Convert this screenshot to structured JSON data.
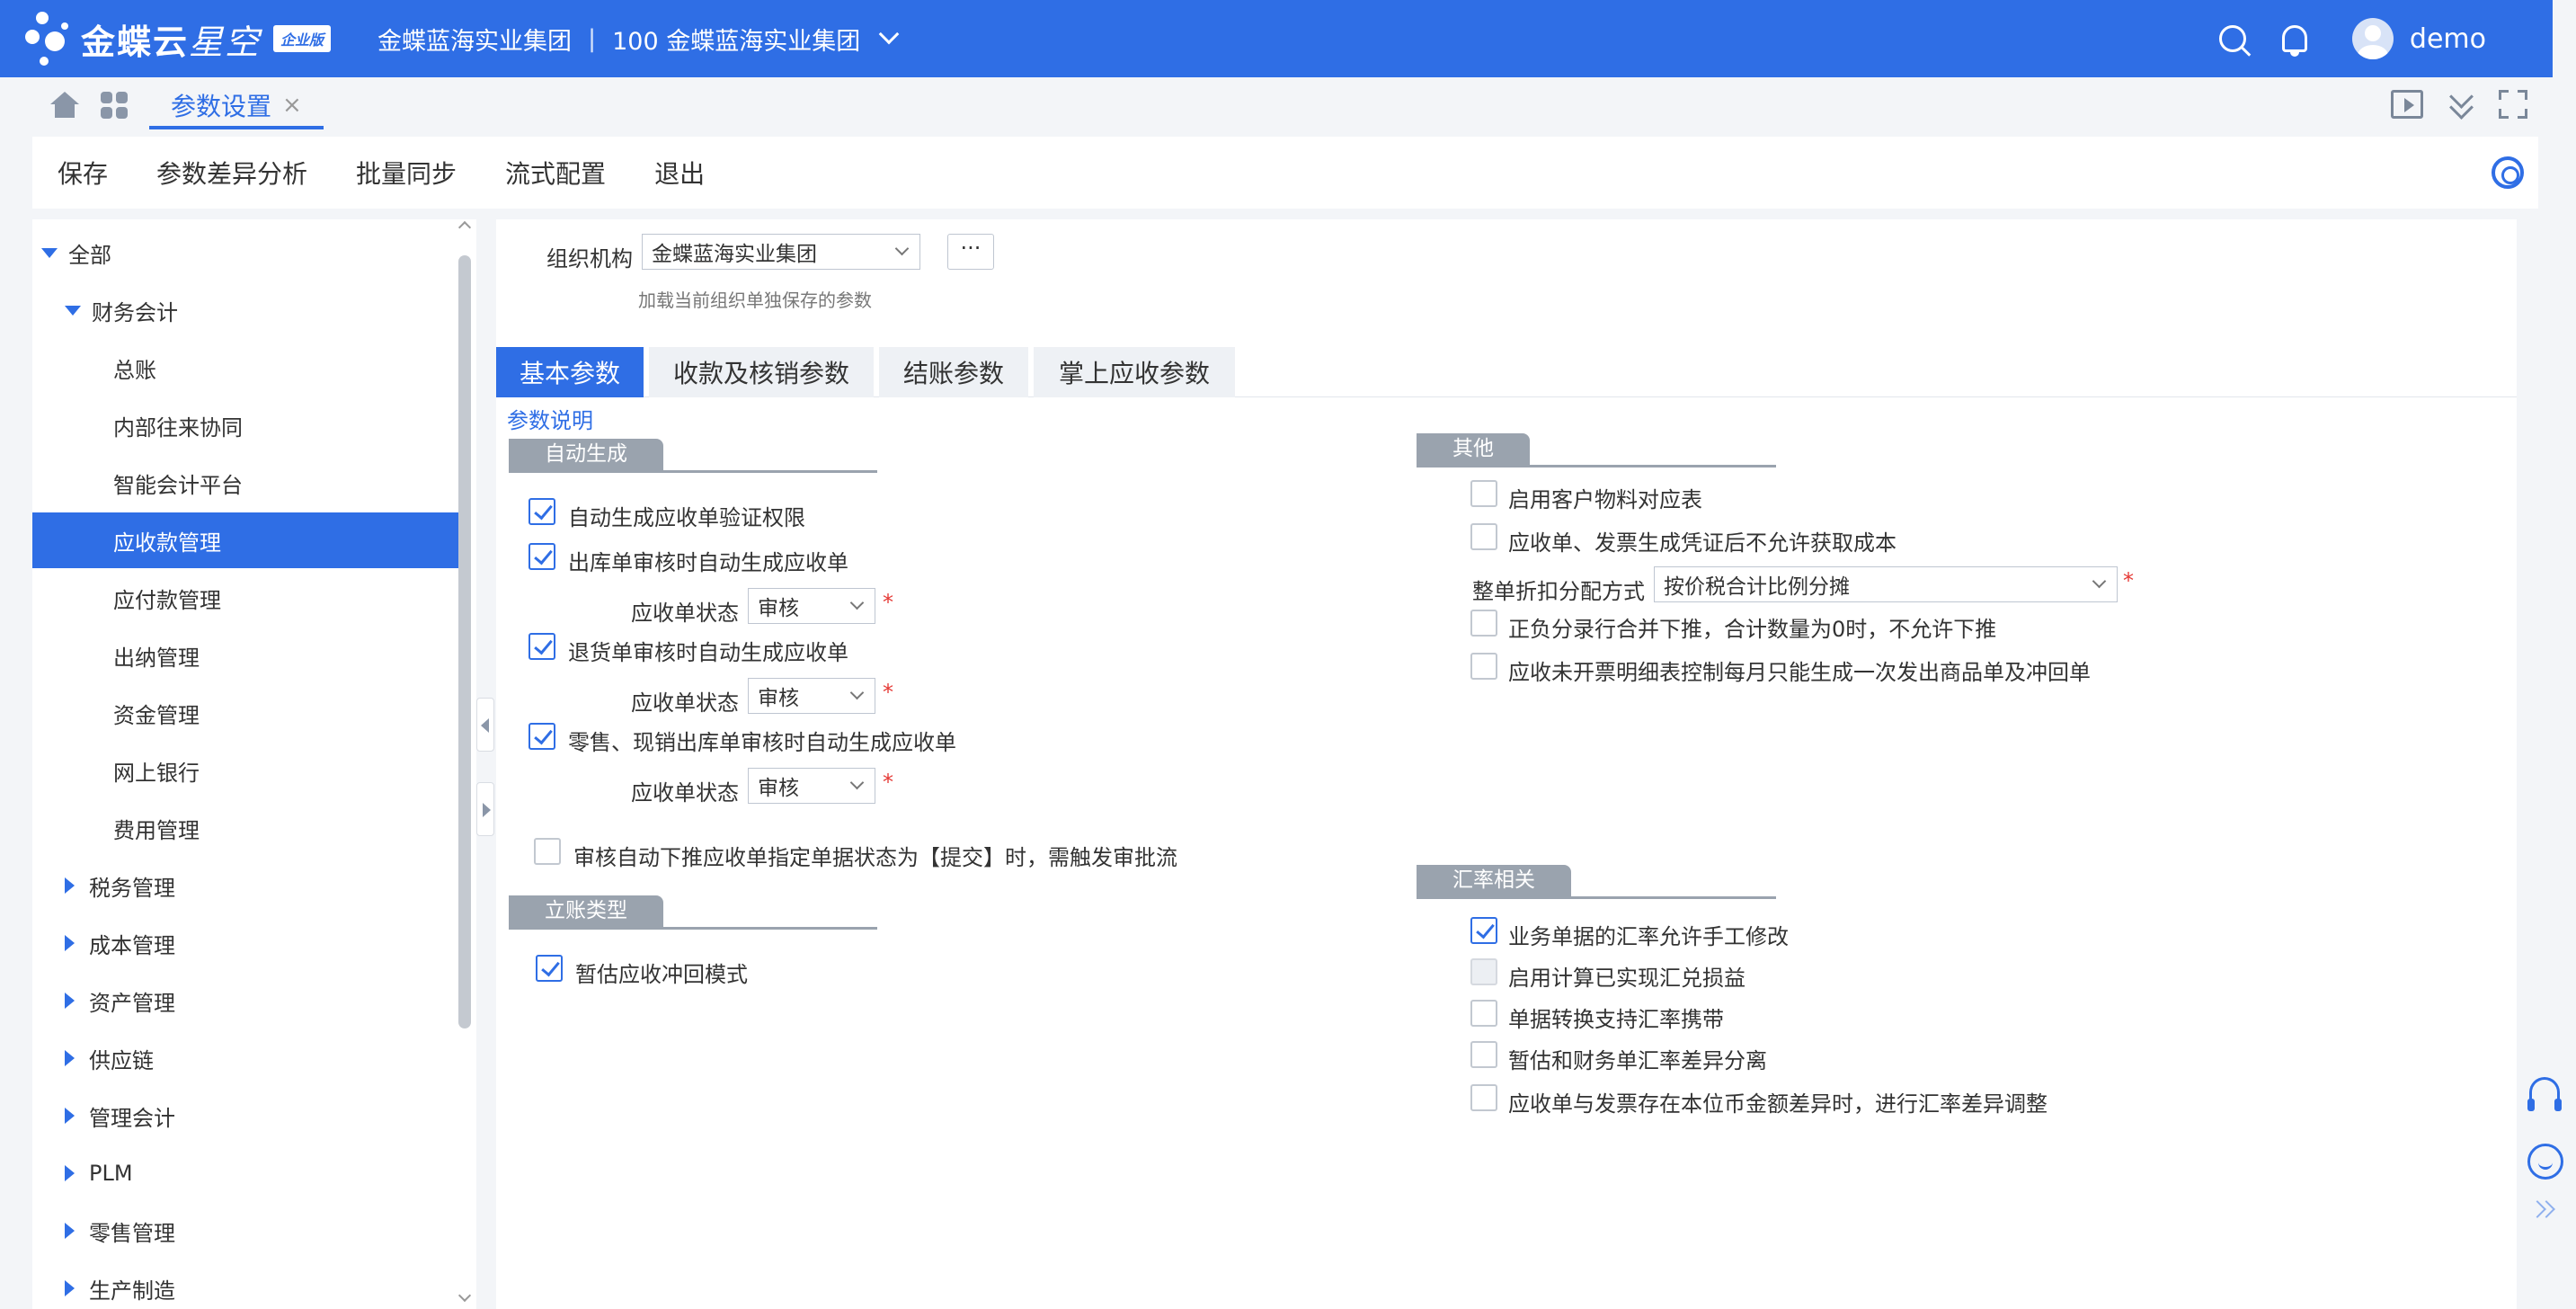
{
  "header": {
    "brand": "金蝶云",
    "brand_italic": "星空",
    "edition": "企业版",
    "org_name": "金蝶蓝海实业集团",
    "org_code_name": "100 金蝶蓝海实业集团",
    "separator": "|",
    "user": "demo"
  },
  "tabbar": {
    "active_tab": "参数设置",
    "close": "×"
  },
  "toolbar": {
    "save": "保存",
    "diff": "参数差异分析",
    "batch_sync": "批量同步",
    "flow_config": "流式配置",
    "exit": "退出"
  },
  "tree": [
    {
      "label": "全部",
      "level": 0,
      "expanded": true
    },
    {
      "label": "财务会计",
      "level": 1,
      "expanded": true
    },
    {
      "label": "总账",
      "level": 2
    },
    {
      "label": "内部往来协同",
      "level": 2
    },
    {
      "label": "智能会计平台",
      "level": 2
    },
    {
      "label": "应收款管理",
      "level": 2,
      "selected": true
    },
    {
      "label": "应付款管理",
      "level": 2
    },
    {
      "label": "出纳管理",
      "level": 2
    },
    {
      "label": "资金管理",
      "level": 2
    },
    {
      "label": "网上银行",
      "level": 2
    },
    {
      "label": "费用管理",
      "level": 2
    },
    {
      "label": "税务管理",
      "level": 1,
      "expanded": false
    },
    {
      "label": "成本管理",
      "level": 1,
      "expanded": false
    },
    {
      "label": "资产管理",
      "level": 1,
      "expanded": false
    },
    {
      "label": "供应链",
      "level": 1,
      "expanded": false
    },
    {
      "label": "管理会计",
      "level": 1,
      "expanded": false
    },
    {
      "label": "PLM",
      "level": 1,
      "expanded": false
    },
    {
      "label": "零售管理",
      "level": 1,
      "expanded": false
    },
    {
      "label": "生产制造",
      "level": 1,
      "expanded": false
    }
  ],
  "org": {
    "label": "组织机构",
    "value": "金蝶蓝海实业集团",
    "more": "···",
    "hint": "加载当前组织单独保存的参数"
  },
  "tabs": [
    {
      "label": "基本参数",
      "active": true
    },
    {
      "label": "收款及核销参数"
    },
    {
      "label": "结账参数"
    },
    {
      "label": "掌上应收参数"
    }
  ],
  "param_link": "参数说明",
  "sections": {
    "auto_gen": "自动生成",
    "account_type": "立账类型",
    "other": "其他",
    "exchange": "汇率相关"
  },
  "status_label": "应收单状态",
  "status_value": "审核",
  "required_mark": "*",
  "left_checks": {
    "c1": "自动生成应收单验证权限",
    "c2": "出库单审核时自动生成应收单",
    "c3": "退货单审核时自动生成应收单",
    "c4": "零售、现销出库单审核时自动生成应收单",
    "c5": "审核自动下推应收单指定单据状态为【提交】时，需触发审批流",
    "c6": "暂估应收冲回模式"
  },
  "other_checks": {
    "o1": "启用客户物料对应表",
    "o2": "应收单、发票生成凭证后不允许获取成本",
    "discount_label": "整单折扣分配方式",
    "discount_value": "按价税合计比例分摊",
    "o3": "正负分录行合并下推，合计数量为0时，不允许下推",
    "o4": "应收未开票明细表控制每月只能生成一次发出商品单及冲回单"
  },
  "exchange_checks": {
    "e1": "业务单据的汇率允许手工修改",
    "e2": "启用计算已实现汇兑损益",
    "e3": "单据转换支持汇率携带",
    "e4": "暂估和财务单汇率差异分离",
    "e5": "应收单与发票存在本位币金额差异时，进行汇率差异调整"
  },
  "colors": {
    "primary": "#2f6ee5",
    "section": "#9aa3ae",
    "required": "#e53935"
  }
}
